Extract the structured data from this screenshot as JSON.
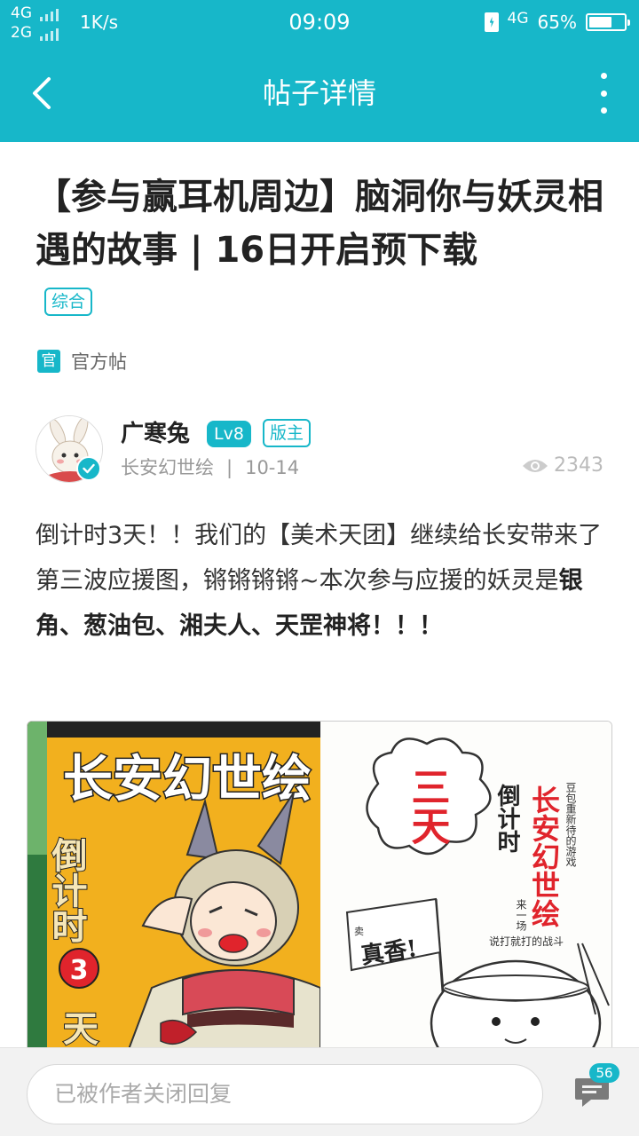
{
  "status_bar": {
    "network_1": "4G",
    "network_2": "2G",
    "speed": "1K/s",
    "time": "09:09",
    "network_right": "4G",
    "battery_percent": "65%",
    "battery_level": 0.65
  },
  "header": {
    "title": "帖子详情"
  },
  "post": {
    "title": "【参与赢耳机周边】脑洞你与妖灵相遇的故事 | 16日开启预下载",
    "category": "综合",
    "official_badge": "官",
    "official_label": "官方帖",
    "author": {
      "name": "广寒兔",
      "level": "Lv8",
      "role": "版主",
      "forum": "长安幻世绘",
      "separator": "|",
      "date": "10-14"
    },
    "views": "2343",
    "body": {
      "text": "倒计时3天！！我们的【美术天团】继续给长安带来了第三波应援图，锵锵锵锵~本次参与应援的妖灵是",
      "highlight": "银角、葱油包、湘夫人、天罡神将！！！"
    },
    "image": {
      "left_title": "长安幻世绘",
      "left_vertical": "倒计时",
      "left_number": "3",
      "left_tail": "天",
      "right_big": "三天",
      "right_countdown": "倒计时",
      "right_brand": "长安幻世绘",
      "right_slogan_1": "豆包重新待的游戏",
      "right_slogan_2": "来一场",
      "right_slogan_3": "说打就打的战斗",
      "flag_text": "真香!",
      "flag_small": "卖"
    }
  },
  "bottom_bar": {
    "reply_placeholder": "已被作者关闭回复",
    "comment_count": "56"
  },
  "colors": {
    "accent": "#17b7c9",
    "poster_yellow": "#f2b01e",
    "poster_red": "#e0242c"
  }
}
